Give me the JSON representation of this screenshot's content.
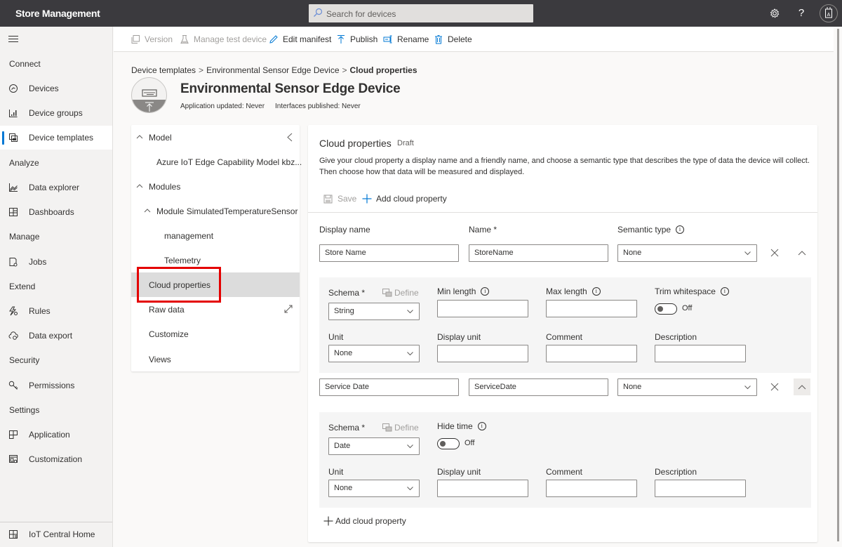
{
  "app": {
    "title": "Store Management",
    "search_placeholder": "Search for devices",
    "icons": {
      "settings": "gear-icon",
      "help": "question-icon",
      "account": "badge-icon"
    }
  },
  "sidebar": {
    "sections": [
      {
        "label": "Connect",
        "items": [
          {
            "label": "Devices",
            "icon": "devices-icon",
            "active": false
          },
          {
            "label": "Device groups",
            "icon": "device-groups-icon",
            "active": false
          },
          {
            "label": "Device templates",
            "icon": "device-templates-icon",
            "active": true
          }
        ]
      },
      {
        "label": "Analyze",
        "items": [
          {
            "label": "Data explorer",
            "icon": "chart-line-icon",
            "active": false
          },
          {
            "label": "Dashboards",
            "icon": "dashboard-icon",
            "active": false
          }
        ]
      },
      {
        "label": "Manage",
        "items": [
          {
            "label": "Jobs",
            "icon": "jobs-icon",
            "active": false
          }
        ]
      },
      {
        "label": "Extend",
        "items": [
          {
            "label": "Rules",
            "icon": "rules-icon",
            "active": false
          },
          {
            "label": "Data export",
            "icon": "cloud-export-icon",
            "active": false
          }
        ]
      },
      {
        "label": "Security",
        "items": [
          {
            "label": "Permissions",
            "icon": "key-icon",
            "active": false
          }
        ]
      },
      {
        "label": "Settings",
        "items": [
          {
            "label": "Application",
            "icon": "application-icon",
            "active": false
          },
          {
            "label": "Customization",
            "icon": "customization-icon",
            "active": false
          }
        ]
      }
    ],
    "footer": {
      "label": "IoT Central Home",
      "icon": "home-grid-icon"
    }
  },
  "commandbar": {
    "version": "Version",
    "manage_test_device": "Manage test device",
    "edit_manifest": "Edit manifest",
    "publish": "Publish",
    "rename": "Rename",
    "delete": "Delete"
  },
  "breadcrumb": {
    "items": [
      "Device templates",
      "Environmental Sensor Edge Device",
      "Cloud properties"
    ],
    "separator": ">"
  },
  "header": {
    "title": "Environmental Sensor Edge Device",
    "app_updated": "Application updated: Never",
    "interfaces_published": "Interfaces published: Never"
  },
  "tree": {
    "model": "Model",
    "capability_model": "Azure IoT Edge Capability Model kbz...",
    "modules": "Modules",
    "module_name": "Module SimulatedTemperatureSensor",
    "management": "management",
    "telemetry": "Telemetry",
    "cloud_properties": "Cloud properties",
    "raw_data": "Raw data",
    "customize": "Customize",
    "views": "Views"
  },
  "card": {
    "title": "Cloud properties",
    "status": "Draft",
    "description": "Give your cloud property a display name and a friendly name, and choose a semantic type that describes the type of data the device will collect. Then choose how that data will be measured and displayed.",
    "save": "Save",
    "add_cloud_property": "Add cloud property",
    "columns": {
      "display_name": "Display name",
      "name": "Name *",
      "semantic_type": "Semantic type"
    },
    "properties": [
      {
        "display_name": "Store Name",
        "name": "StoreName",
        "semantic_type": "None",
        "schema_label": "Schema *",
        "define": "Define",
        "schema": "String",
        "min_length_label": "Min length",
        "min_length": "",
        "max_length_label": "Max length",
        "max_length": "",
        "trim_label": "Trim whitespace",
        "trim_state": "Off",
        "unit_label": "Unit",
        "unit": "None",
        "display_unit_label": "Display unit",
        "display_unit": "",
        "comment_label": "Comment",
        "comment": "",
        "description_label": "Description",
        "description": ""
      },
      {
        "display_name": "Service Date",
        "name": "ServiceDate",
        "semantic_type": "None",
        "schema_label": "Schema *",
        "define": "Define",
        "schema": "Date",
        "hide_time_label": "Hide time",
        "hide_time_state": "Off",
        "unit_label": "Unit",
        "unit": "None",
        "display_unit_label": "Display unit",
        "display_unit": "",
        "comment_label": "Comment",
        "comment": "",
        "description_label": "Description",
        "description": ""
      }
    ],
    "add_cloud_property_bottom": "Add cloud property"
  }
}
